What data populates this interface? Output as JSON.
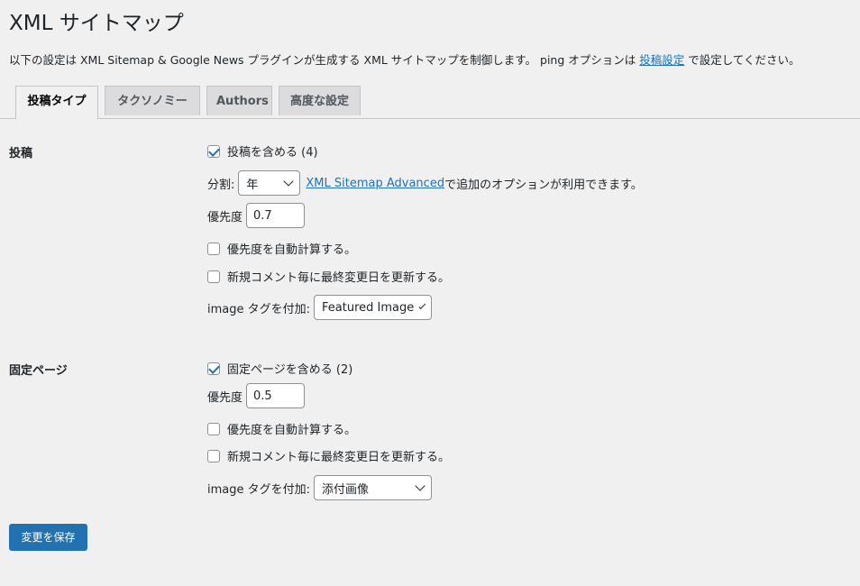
{
  "page": {
    "title": "XML サイトマップ",
    "description_prefix": "以下の設定は XML Sitemap & Google News プラグインが生成する XML サイトマップを制御します。 ping オプションは ",
    "description_link": "投稿設定",
    "description_suffix": " で設定してください。"
  },
  "tabs": [
    {
      "label": "投稿タイプ",
      "active": true
    },
    {
      "label": "タクソノミー",
      "active": false
    },
    {
      "label": "Authors",
      "active": false
    },
    {
      "label": "高度な設定",
      "active": false
    }
  ],
  "posts": {
    "section_label": "投稿",
    "include_label": "投稿を含める (4)",
    "include_checked": true,
    "split_label": "分割:",
    "split_value": "年",
    "advanced_link": "XML Sitemap Advanced",
    "advanced_suffix": " で追加のオプションが利用できます。",
    "priority_label": "優先度",
    "priority_value": "0.7",
    "auto_priority_label": "優先度を自動計算する。",
    "auto_priority_checked": false,
    "update_lastmod_label": "新規コメント毎に最終変更日を更新する。",
    "update_lastmod_checked": false,
    "image_label": "image タグを付加:",
    "image_value": "Featured Image"
  },
  "pages": {
    "section_label": "固定ページ",
    "include_label": "固定ページを含める (2)",
    "include_checked": true,
    "priority_label": "優先度",
    "priority_value": "0.5",
    "auto_priority_label": "優先度を自動計算する。",
    "auto_priority_checked": false,
    "update_lastmod_label": "新規コメント毎に最終変更日を更新する。",
    "update_lastmod_checked": false,
    "image_label": "image タグを付加:",
    "image_value": "添付画像"
  },
  "actions": {
    "save_label": "変更を保存"
  },
  "colors": {
    "accent": "#2271b1",
    "background": "#f0f0f1"
  }
}
